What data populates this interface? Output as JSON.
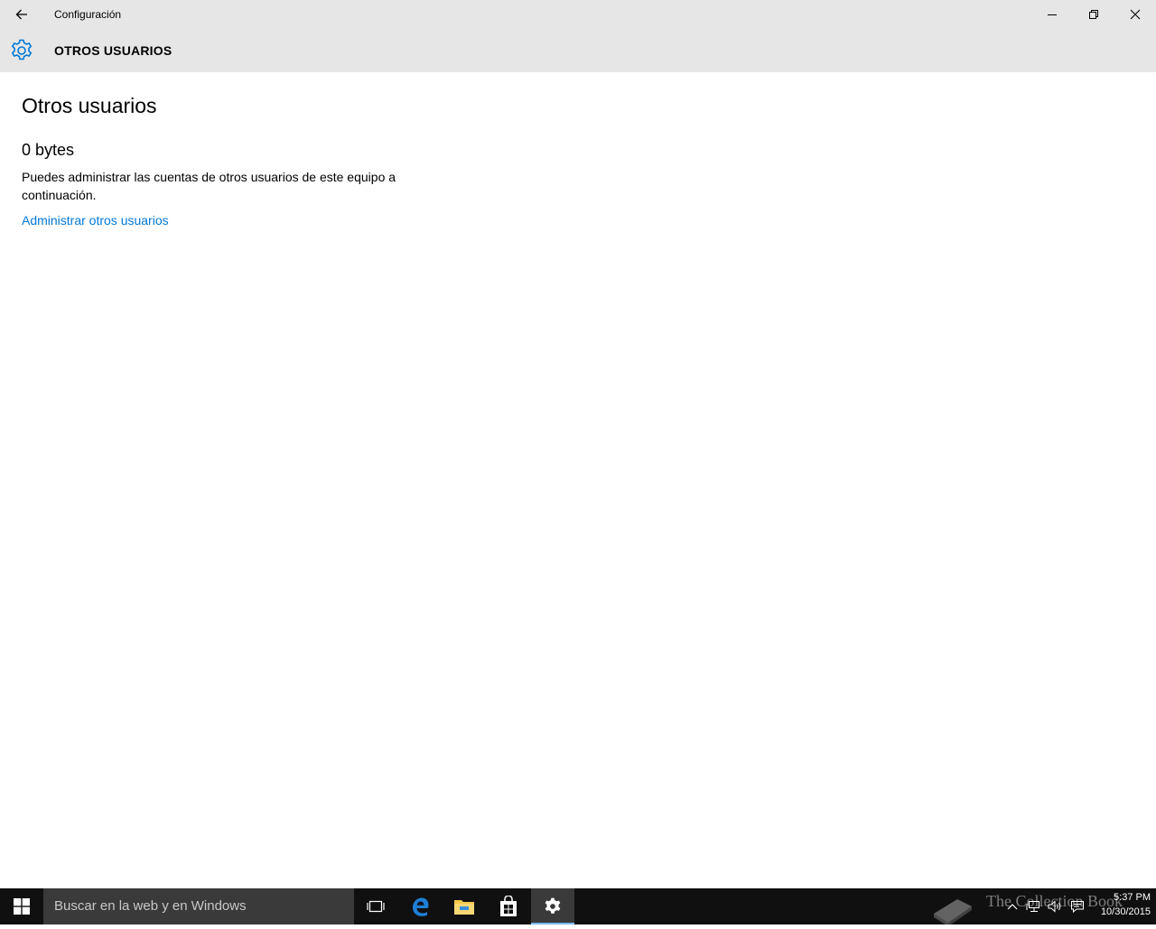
{
  "window": {
    "title": "Configuración",
    "header_title": "OTROS USUARIOS"
  },
  "main": {
    "page_title": "Otros usuarios",
    "size_heading": "0 bytes",
    "description": "Puedes administrar las cuentas de otros usuarios de este equipo a continuación.",
    "manage_link": "Administrar otros usuarios"
  },
  "taskbar": {
    "search_placeholder": "Buscar en la web y en Windows",
    "apps": [
      "task-view",
      "edge",
      "file-explorer",
      "store",
      "settings"
    ],
    "active_app": "settings",
    "watermark": "The Collection Book",
    "clock_time": "5:37 PM",
    "clock_date": "10/30/2015"
  },
  "colors": {
    "accent": "#0078d7",
    "titlebar_bg": "#e6e6e6",
    "taskbar_bg": "#101010"
  }
}
